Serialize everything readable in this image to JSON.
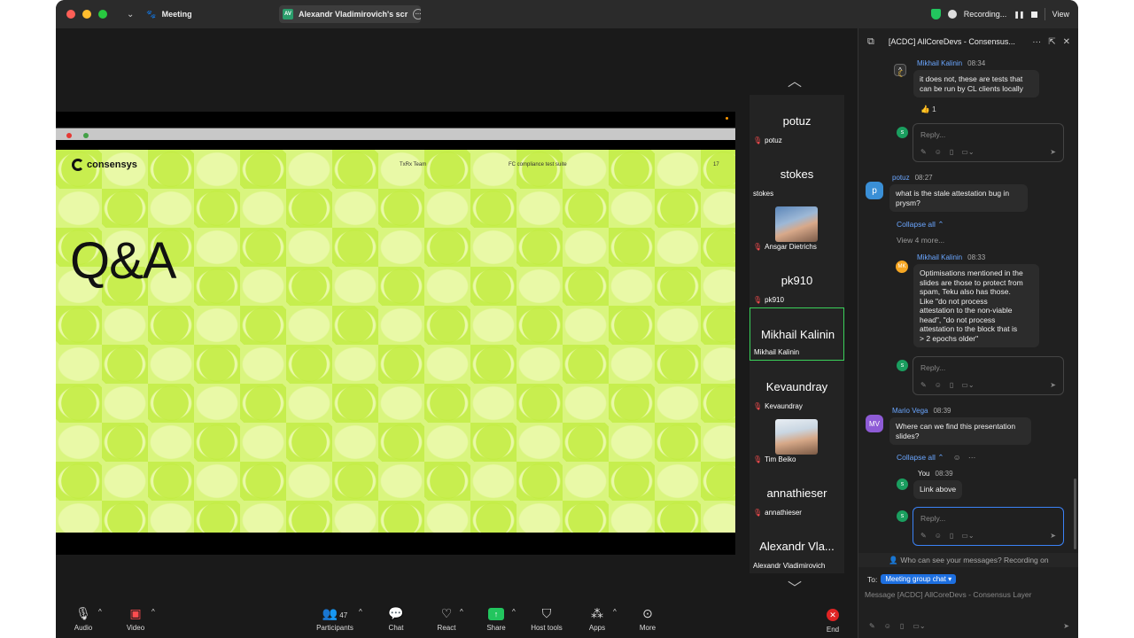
{
  "titlebar": {
    "meeting_label": "Meeting",
    "share_title": "Alexandr Vladimirovich's scr",
    "share_initials": "AV",
    "recording_label": "Recording...",
    "view_label": "View"
  },
  "slide": {
    "logo_text": "consensys",
    "header_team": "TxRx Team",
    "header_title": "FC compliance test suite",
    "page_number": "17",
    "heading": "Q&A"
  },
  "gallery": {
    "tiles": [
      {
        "big": "potuz",
        "small": "potuz"
      },
      {
        "big": "stokes",
        "small": "stokes"
      },
      {
        "big": "",
        "small": "Ansgar Dietrichs"
      },
      {
        "big": "pk910",
        "small": "pk910"
      },
      {
        "big": "Mikhail Kalinin",
        "small": "Mikhail Kalinin"
      },
      {
        "big": "Kevaundray",
        "small": "Kevaundray"
      },
      {
        "big": "",
        "small": "Tim Beiko"
      },
      {
        "big": "annathieser",
        "small": "annathieser"
      },
      {
        "big": "Alexandr Vla...",
        "small": "Alexandr Vladimirovich"
      }
    ]
  },
  "toolbar": {
    "audio": "Audio",
    "video": "Video",
    "participants": "Participants",
    "participants_count": "47",
    "chat": "Chat",
    "react": "React",
    "share": "Share",
    "host_tools": "Host tools",
    "apps": "Apps",
    "more": "More",
    "end": "End"
  },
  "chat": {
    "title": "[ACDC] AllCoreDevs - Consensus...",
    "thread1": {
      "name": "Mikhail Kalinin",
      "time": "08:34",
      "text1": "it does not, these are tests that",
      "text2": "can be run by CL clients locally",
      "reaction": "👍 1"
    },
    "reply_placeholder": "Reply...",
    "potuz": {
      "name": "potuz",
      "time": "08:27",
      "initial": "p",
      "text1": "what is the stale attestation bug in",
      "text2": "prysm?"
    },
    "collapse_all": "Collapse all",
    "view_more": "View 4 more...",
    "mk": {
      "name": "Mikhail Kalinin",
      "time": "08:33",
      "initials": "MK",
      "lines": [
        "Optimisations mentioned in the",
        "slides are those to protect from",
        "spam, Teku also has those.",
        "Like \"do not process",
        "attestation to the non-viable",
        "head\", \"do not process",
        "attestation to the block that is",
        "> 2 epochs older\""
      ]
    },
    "mv": {
      "name": "Mario Vega",
      "time": "08:39",
      "initials": "MV",
      "text1": "Where can we find this presentation",
      "text2": "slides?"
    },
    "you": {
      "name": "You",
      "time": "08:39",
      "text": "Link above"
    },
    "footer_note": "Who can see your messages? Recording on",
    "to_label": "To:",
    "to_chip": "Meeting group chat",
    "compose_placeholder": "Message [ACDC] AllCoreDevs - Consensus Layer"
  },
  "colors": {
    "accent": "#3b82f6",
    "slide_green": "#c6ee4e",
    "active_tile": "#3ad15a",
    "end_red": "#e02424"
  }
}
